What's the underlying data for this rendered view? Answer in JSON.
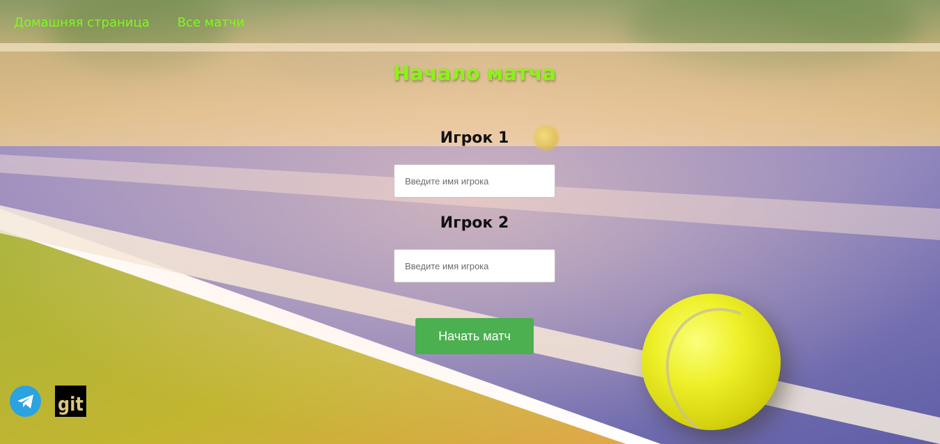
{
  "nav": {
    "home_label": "Домашняя страница",
    "matches_label": "Все матчи",
    "link_color": "#7cfc1a"
  },
  "form": {
    "title": "Начало матча",
    "player1_label": "Игрок 1",
    "player1_placeholder": "Введите имя игрока",
    "player1_value": "",
    "player2_label": "Игрок 2",
    "player2_placeholder": "Введите имя игрока",
    "player2_value": "",
    "submit_label": "Начать матч",
    "title_color": "#8cf21a",
    "button_color": "#4caf50"
  },
  "footer": {
    "telegram_icon": "telegram-icon",
    "git_icon": "git-icon",
    "git_text": "git",
    "telegram_color": "#2aa3e0"
  }
}
